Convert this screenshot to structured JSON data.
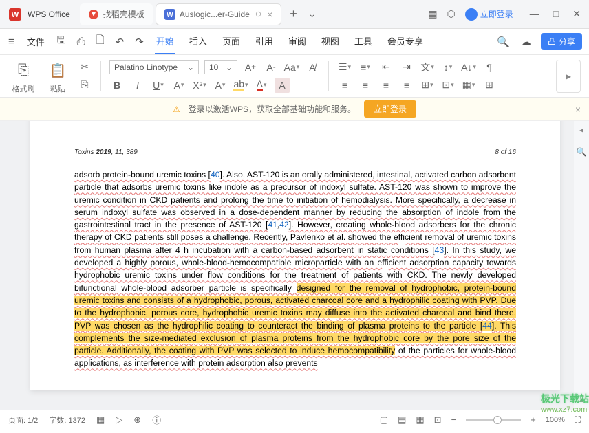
{
  "app": {
    "name": "WPS Office"
  },
  "tabs": {
    "template": "找稻壳模板",
    "active": "Auslogic...er-Guide"
  },
  "titlebar": {
    "login": "立即登录"
  },
  "menu": {
    "file": "文件",
    "items": [
      "开始",
      "插入",
      "页面",
      "引用",
      "审阅",
      "视图",
      "工具",
      "会员专享"
    ],
    "share": "分享"
  },
  "toolbar": {
    "format_painter": "格式刷",
    "paste": "粘贴",
    "font": "Palatino Linotype",
    "size": "10"
  },
  "banner": {
    "text": "登录以激活WPS，获取全部基础功能和服务。",
    "btn": "立即登录"
  },
  "doc": {
    "journal": "Toxins",
    "year": "2019",
    "vol": ", 11, 389",
    "page_of": "8 of 16",
    "p1_a": "adsorb protein-bound uremic toxins [",
    "r40": "40",
    "p1_b": "]. Also, AST-120 is an orally administered, intestinal, activated carbon adsorbent particle that adsorbs uremic toxins like indole as a precursor of indoxyl sulfate. AST-120 was shown to improve the uremic condition in CKD patients and prolong the time to initiation of hemodialysis. More specifically, a decrease in serum indoxyl sulfate was observed in a dose-dependent manner by reducing the absorption of indole from the gastrointestinal tract in the presence of AST-120 [",
    "r41": "41",
    "r42": "42",
    "p1_c": "]. However, creating whole-blood adsorbers for the chronic therapy of CKD patients still poses a challenge. Recently, Pavlenko et al. showed the e",
    "eff1": "ffi",
    "p1_d": "cient removal of uremic toxins from human plasma after 4 h incubation with a carbon-based adsorbent in static conditions [",
    "r43": "43",
    "p1_e": "]. In this study, we developed a highly porous, whole-blood-hemocompatible microparticle with an e",
    "eff2": "ffi",
    "p1_f": "cient adsorption capacity towards hydrophobic uremic toxins under flow conditions for the treatment of patients with CKD. The newly developed bifunctional whole-blood adsorber particle is specifically ",
    "hl1": "designed for the removal of hydrophobic, protein-bound uremic toxins and consists of a hydrophobic, porous, activated charcoal core and a hydrophilic coating with PVP. Due to the hydrophobic, porous core, hydrophobic uremic toxins may di",
    "hl_ff": "ff",
    "hl2": "use into the activated charcoal and bind there.  PVP was chosen as the hydrophilic coating to counteract the binding of plasma proteins to the particle [",
    "r44": "44",
    "hl3": "]. This complements the size-mediated exclusion of plasma proteins from the hydrophobic core by the pore size of the particle. Additionally, the coating with PVP was selected to induce hemocompatibility",
    "p1_g": " of the particles for whole-blood applications, as interference with protein adsorption also prevents"
  },
  "status": {
    "page": "页面: 1/2",
    "words": "字数: 1372",
    "zoom": "100%"
  },
  "watermark": {
    "line1": "极光下载站",
    "line2": "www.xz7.com"
  }
}
